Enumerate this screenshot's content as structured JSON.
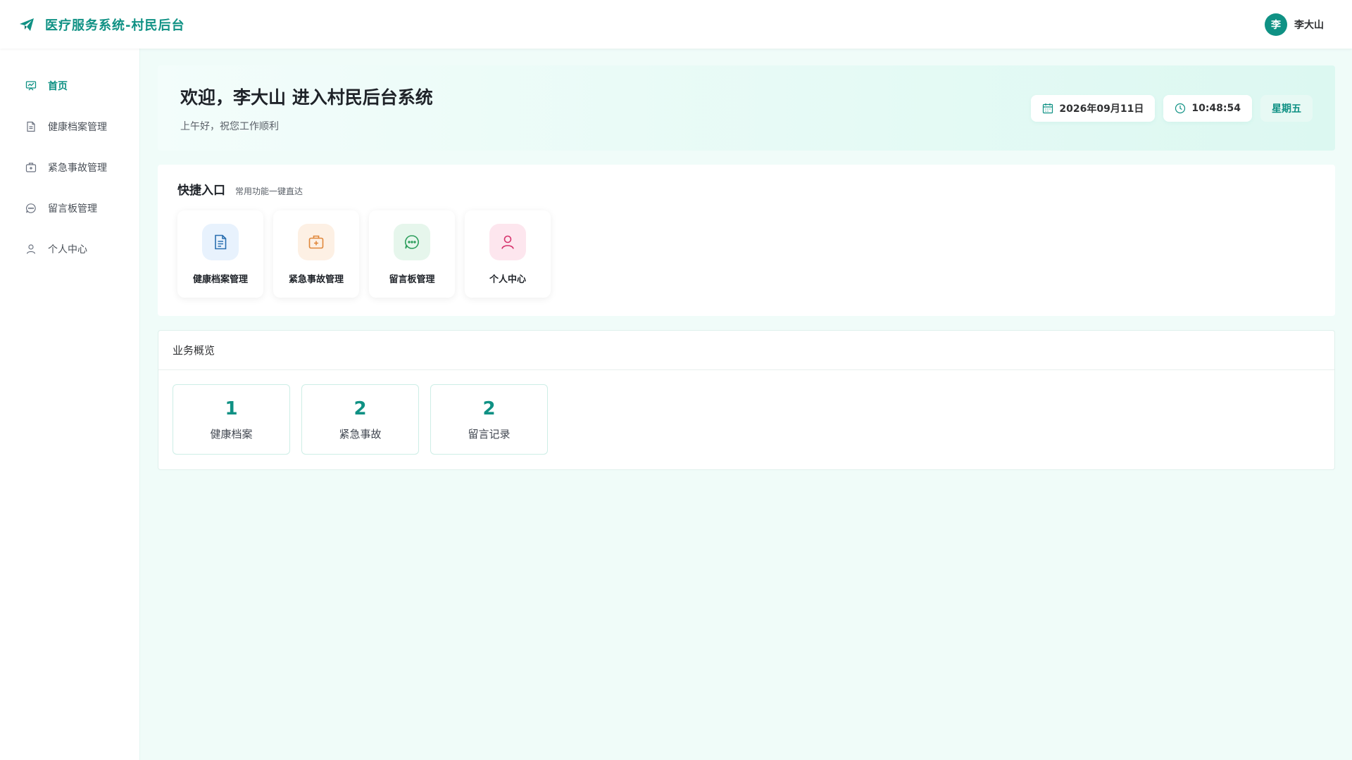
{
  "app": {
    "title": "医疗服务系统-村民后台",
    "icon": "paper-plane-icon",
    "accent_color": "#0f9184"
  },
  "user": {
    "avatar_text": "李",
    "name": "李大山"
  },
  "sidebar": {
    "items": [
      {
        "label": "首页",
        "icon": "dashboard-icon",
        "active": true
      },
      {
        "label": "健康档案管理",
        "icon": "document-icon",
        "active": false
      },
      {
        "label": "紧急事故管理",
        "icon": "medical-kit-icon",
        "active": false
      },
      {
        "label": "留言板管理",
        "icon": "chat-icon",
        "active": false
      },
      {
        "label": "个人中心",
        "icon": "user-icon",
        "active": false
      }
    ]
  },
  "welcome": {
    "title": "欢迎，李大山 进入村民后台系统",
    "subtitle": "上午好，祝您工作顺利",
    "date": "2026年09月11日",
    "time": "10:48:54",
    "weekday": "星期五"
  },
  "quick": {
    "title": "快捷入口",
    "subtitle": "常用功能一键直达",
    "items": [
      {
        "label": "健康档案管理",
        "icon": "document-icon",
        "color": "#2a6fb0",
        "bg": "#e8f2fd"
      },
      {
        "label": "紧急事故管理",
        "icon": "medical-kit-icon",
        "color": "#e0873a",
        "bg": "#fdf0e4"
      },
      {
        "label": "留言板管理",
        "icon": "chat-icon",
        "color": "#2f9f5e",
        "bg": "#e6f6ec"
      },
      {
        "label": "个人中心",
        "icon": "user-icon",
        "color": "#d6336c",
        "bg": "#fde6ee"
      }
    ]
  },
  "overview": {
    "title": "业务概览",
    "stats": [
      {
        "value": "1",
        "label": "健康档案"
      },
      {
        "value": "2",
        "label": "紧急事故"
      },
      {
        "value": "2",
        "label": "留言记录"
      }
    ]
  }
}
